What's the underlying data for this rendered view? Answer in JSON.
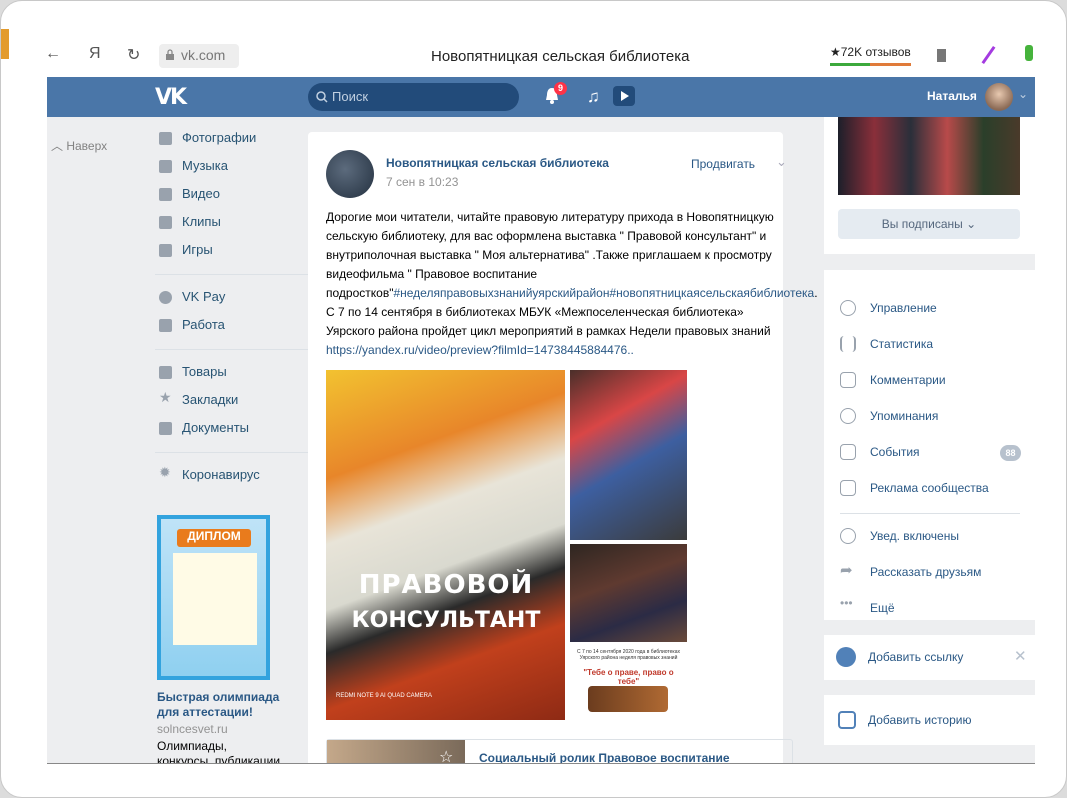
{
  "browser": {
    "nav_back": "←",
    "yandex": "Я",
    "reload": "↻",
    "url": "vk.com",
    "page_title": "Новопятницкая сельская библиотека",
    "reviews": "★72K отзывов"
  },
  "header": {
    "search_placeholder": "Поиск",
    "notif_count": "9",
    "user_name": "Наталья"
  },
  "left": {
    "back": "Наверх",
    "nav": [
      {
        "label": "Фотографии"
      },
      {
        "label": "Музыка"
      },
      {
        "label": "Видео"
      },
      {
        "label": "Клипы"
      },
      {
        "label": "Игры"
      },
      {
        "label": "VK Pay"
      },
      {
        "label": "Работа"
      },
      {
        "label": "Товары"
      },
      {
        "label": "Закладки"
      },
      {
        "label": "Документы"
      },
      {
        "label": "Коронавирус"
      }
    ],
    "ad": {
      "banner_word": "ДИПЛОМ",
      "title": "Быстрая олимпиада для аттестации!",
      "site": "solncesvet.ru",
      "desc": "Олимпиады, конкурсы, публикации для"
    }
  },
  "post": {
    "author": "Новопятницкая сельская библиотека",
    "date": "7 сен в 10:23",
    "promote": "Продвигать",
    "text1": "Дорогие мои читатели, читайте правовую литературу прихода в Новопятницкую сельскую библиотеку, для вас оформлена выставка \" Правовой консультант\" и внутриполочная выставка \" Моя альтернатива\" .Также приглашаем к просмотру видеофильма \" Правовое воспитание подростков\"",
    "tags": "#неделяправовыхзнанийуярскийрайон#новопятницкаясельскаябиблиотека",
    "text2": ". С 7 по 14 сентября в библиотеках МБУК «Межпоселенческая библиотека» Уярского района пройдет цикл мероприятий в рамках Недели правовых знаний",
    "link": "https://yandex.ru/video/preview?filmId=14738445884476..",
    "photo_line1": "ПРАВОВОЙ",
    "photo_line2": "КОНСУЛЬТАНТ",
    "camera": "REDMI NOTE 9 AI QUAD CAMERA",
    "poster_small": "С 7 по 14 сентября 2020 года в библиотеках Уярского района неделя правовых знаний",
    "poster_title": "\"Тебе о праве, право о тебе\"",
    "attachment_title": "Социальный ролик Правовое воспитание подростков"
  },
  "right": {
    "subscribed": "Вы подписаны",
    "menu": [
      {
        "label": "Управление"
      },
      {
        "label": "Статистика"
      },
      {
        "label": "Комментарии"
      },
      {
        "label": "Упоминания"
      },
      {
        "label": "События",
        "badge": "88"
      },
      {
        "label": "Реклама сообщества"
      },
      {
        "label": "Увед. включены"
      },
      {
        "label": "Рассказать друзьям"
      },
      {
        "label": "Ещё"
      }
    ],
    "add_link": "Добавить ссылку",
    "add_story": "Добавить историю"
  },
  "colors": {
    "vk_blue": "#4a76a8",
    "link": "#2a5885",
    "bg": "#edeef0"
  }
}
